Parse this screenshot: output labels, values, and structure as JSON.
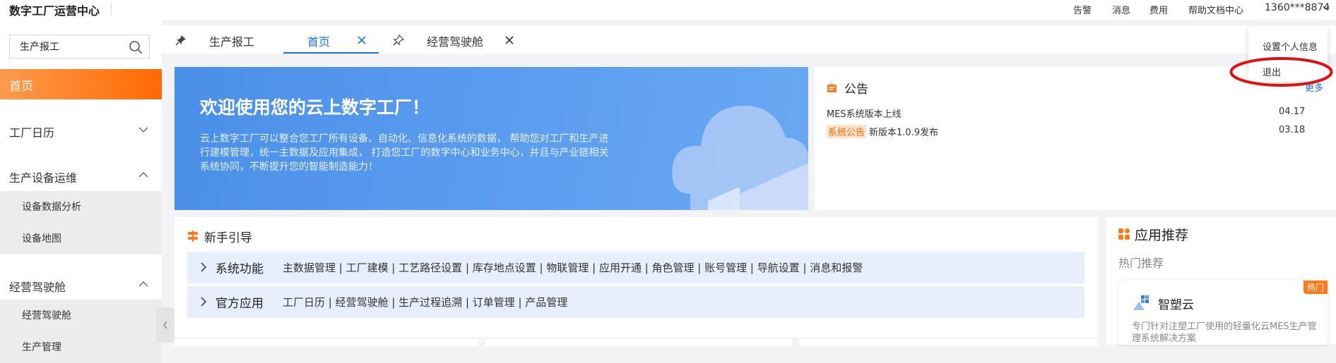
{
  "topbar": {
    "title": "数字工厂运营中心",
    "nav": [
      "告警",
      "消息",
      "费用",
      "帮助文档中心"
    ],
    "user": "1360***8874"
  },
  "sidebar": {
    "search_value": "生产报工",
    "home": "首页",
    "groups": [
      {
        "label": "工厂日历"
      },
      {
        "label": "生产设备运维",
        "items": [
          "设备数据分析",
          "设备地图"
        ]
      },
      {
        "label": "经营驾驶舱",
        "items": [
          "经营驾驶舱",
          "生产管理"
        ]
      }
    ]
  },
  "tabs": [
    {
      "label": "生产报工"
    },
    {
      "label": "首页",
      "active": true
    },
    {
      "label": "经营驾驶舱"
    }
  ],
  "banner": {
    "title": "欢迎使用您的云上数字工厂！",
    "desc": "云上数字工厂可以整合您工厂所有设备、自动化、信息化系统的数据， 帮助您对工厂和生产进行建模管理，统一主数据及应用集成， 打造您工厂的数字中心和业务中心，并且与产业链相关系统协同，不断提升您的智能制造能力！"
  },
  "notice": {
    "title": "公告",
    "more": "更多",
    "rows": [
      {
        "text": "MES系统版本上线",
        "date": "04.17"
      },
      {
        "badge": "系统公告",
        "text": "新版本1.0.9发布",
        "date": "03.18"
      }
    ]
  },
  "dropdown": {
    "items": [
      "设置个人信息",
      "退出"
    ]
  },
  "guide": {
    "title": "新手引导",
    "bands": [
      {
        "name": "系统功能",
        "links": "主数据管理 | 工厂建模 | 工艺路径设置 | 库存地点设置 | 物联管理 | 应用开通 | 角色管理 | 账号管理 | 导航设置 | 消息和报警"
      },
      {
        "name": "官方应用",
        "links": "工厂日历 | 经营驾驶舱 | 生产过程追溯 | 订单管理 | 产品管理"
      }
    ]
  },
  "apps": {
    "title": "应用推荐",
    "subtitle": "热门推荐",
    "card": {
      "hot": "热门",
      "name": "智塑云",
      "desc": "专门针对注塑工厂使用的轻量化云MES生产管理系统解决方案"
    }
  },
  "colors": {
    "accent": "#ff6a00",
    "primary": "#1f6fe5",
    "banner": "#4a8fe8"
  }
}
